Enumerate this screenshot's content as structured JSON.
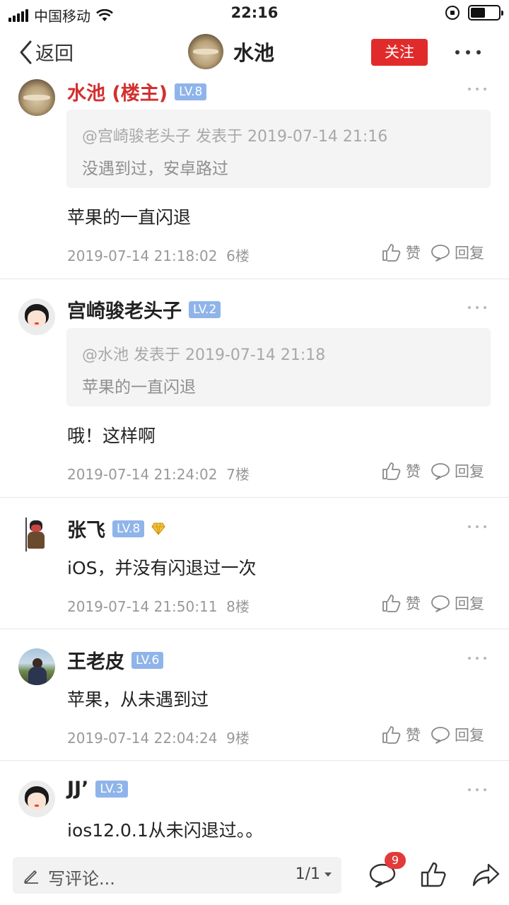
{
  "status_bar": {
    "carrier": "中国移动",
    "time": "22:16"
  },
  "nav": {
    "back_label": "返回",
    "title": "水池",
    "follow_label": "关注"
  },
  "posts": [
    {
      "author": "水池 (楼主)",
      "level": "LV.8",
      "quote": {
        "header": "@宫崎骏老头子 发表于 2019-07-14 21:16",
        "text": "没遇到过，安卓路过"
      },
      "content": "苹果的一直闪退",
      "datetime": "2019-07-14 21:18:02",
      "floor": "6楼"
    },
    {
      "author": "宫崎骏老头子",
      "level": "LV.2",
      "quote": {
        "header": "@水池 发表于 2019-07-14 21:18",
        "text": "苹果的一直闪退"
      },
      "content": "哦！这样啊",
      "datetime": "2019-07-14 21:24:02",
      "floor": "7楼"
    },
    {
      "author": "张飞",
      "level": "LV.8",
      "content": "iOS，并没有闪退过一次",
      "datetime": "2019-07-14 21:50:11",
      "floor": "8楼"
    },
    {
      "author": "王老皮",
      "level": "LV.6",
      "content": "苹果，从未遇到过",
      "datetime": "2019-07-14 22:04:24",
      "floor": "9楼"
    },
    {
      "author": "JJ’",
      "level": "LV.3",
      "content": "ios12.0.1从未闪退过。。"
    }
  ],
  "actions": {
    "like_label": "赞",
    "reply_label": "回复"
  },
  "bottom_bar": {
    "comment_placeholder": "写评论...",
    "page_indicator": "1/1",
    "comment_count": "9"
  },
  "colors": {
    "accent_red": "#e12b2b",
    "level_badge": "#8fb4ea",
    "op_author": "#d23030"
  }
}
